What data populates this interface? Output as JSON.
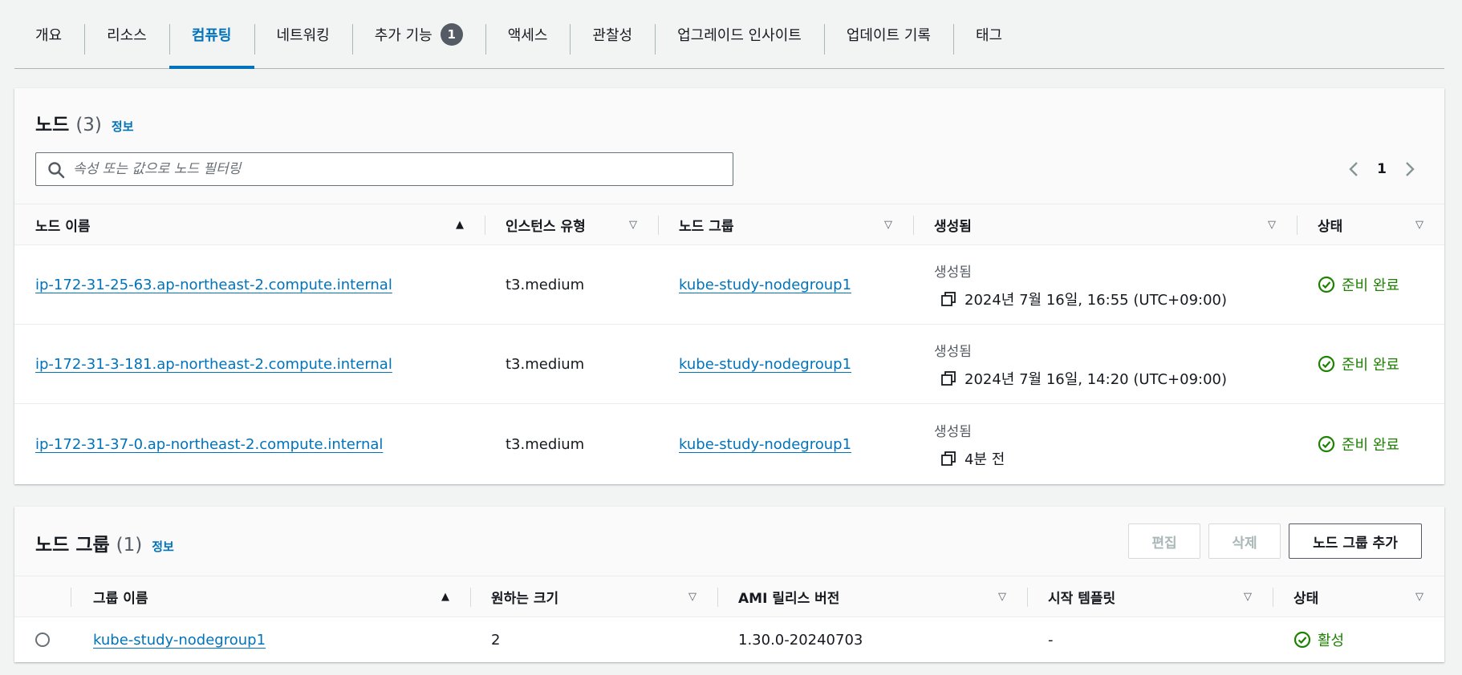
{
  "tabs": [
    {
      "label": "개요"
    },
    {
      "label": "리소스"
    },
    {
      "label": "컴퓨팅",
      "active": true
    },
    {
      "label": "네트워킹"
    },
    {
      "label": "추가 기능",
      "badge": "1"
    },
    {
      "label": "액세스"
    },
    {
      "label": "관찰성"
    },
    {
      "label": "업그레이드 인사이트"
    },
    {
      "label": "업데이트 기록"
    },
    {
      "label": "태그"
    }
  ],
  "nodes": {
    "title": "노드",
    "count": "(3)",
    "info": "정보",
    "search_placeholder": "속성 또는 값으로 노드 필터링",
    "page": "1",
    "columns": [
      "노드 이름",
      "인스턴스 유형",
      "노드 그룹",
      "생성됨",
      "상태"
    ],
    "rows": [
      {
        "name": "ip-172-31-25-63.ap-northeast-2.compute.internal",
        "type": "t3.medium",
        "group": "kube-study-nodegroup1",
        "created_label": "생성됨",
        "created": "2024년 7월 16일, 16:55 (UTC+09:00)",
        "status": "준비 완료"
      },
      {
        "name": "ip-172-31-3-181.ap-northeast-2.compute.internal",
        "type": "t3.medium",
        "group": "kube-study-nodegroup1",
        "created_label": "생성됨",
        "created": "2024년 7월 16일, 14:20 (UTC+09:00)",
        "status": "준비 완료"
      },
      {
        "name": "ip-172-31-37-0.ap-northeast-2.compute.internal",
        "type": "t3.medium",
        "group": "kube-study-nodegroup1",
        "created_label": "생성됨",
        "created": "4분 전",
        "status": "준비 완료"
      }
    ]
  },
  "nodegroups": {
    "title": "노드 그룹",
    "count": "(1)",
    "info": "정보",
    "edit_label": "편집",
    "delete_label": "삭제",
    "add_label": "노드 그룹 추가",
    "columns": [
      "그룹 이름",
      "원하는 크기",
      "AMI 릴리스 버전",
      "시작 템플릿",
      "상태"
    ],
    "rows": [
      {
        "name": "kube-study-nodegroup1",
        "desired": "2",
        "ami": "1.30.0-20240703",
        "template": "-",
        "status": "활성"
      }
    ]
  },
  "colors": {
    "accent": "#0073bb",
    "success": "#1d8102",
    "text": "#16191f"
  }
}
